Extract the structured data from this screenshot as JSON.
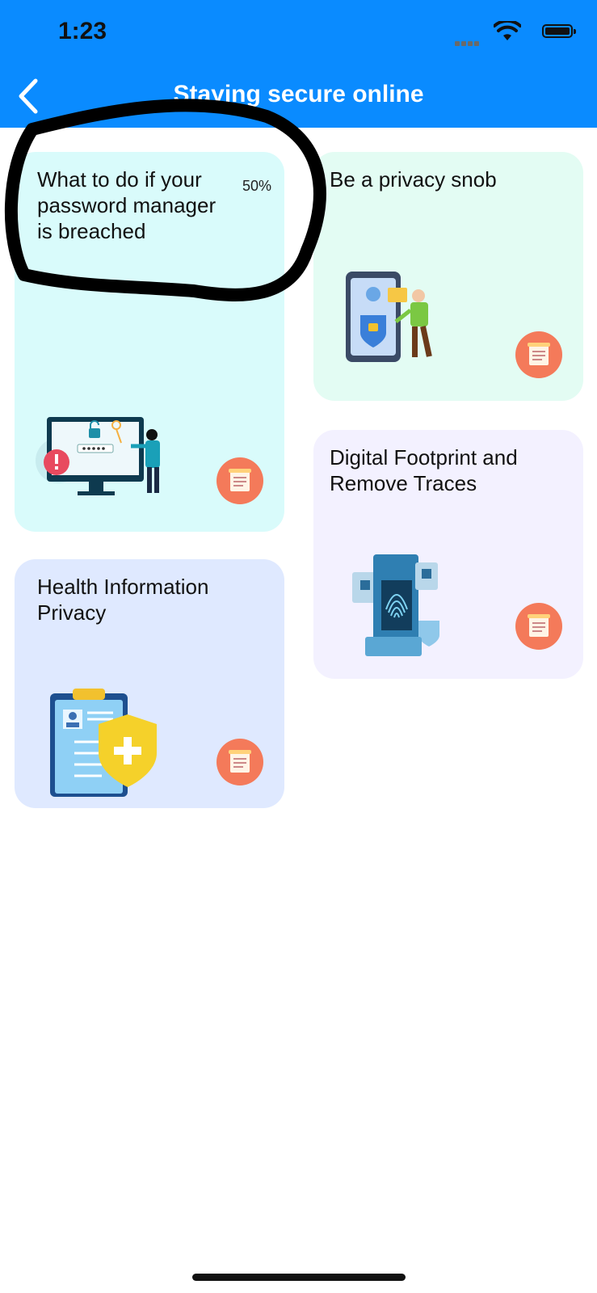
{
  "status_bar": {
    "time": "1:23"
  },
  "nav": {
    "title": "Staying secure online",
    "back_icon": "chevron-left-icon"
  },
  "cards": [
    {
      "title": "What to do if your password manager is breached",
      "progress": "50%",
      "icon": "document-icon"
    },
    {
      "title": "Be a privacy snob",
      "icon": "document-icon"
    },
    {
      "title": "Digital Footprint and Remove Traces",
      "icon": "document-icon"
    },
    {
      "title": "Health Information Privacy",
      "icon": "document-icon"
    }
  ],
  "colors": {
    "header": "#0a8bff",
    "card_password": "#d9fbfb",
    "card_snob": "#e3fcf3",
    "card_footprint": "#f3f1ff",
    "card_health": "#dfe9ff",
    "read_button": "#f47a5a"
  }
}
